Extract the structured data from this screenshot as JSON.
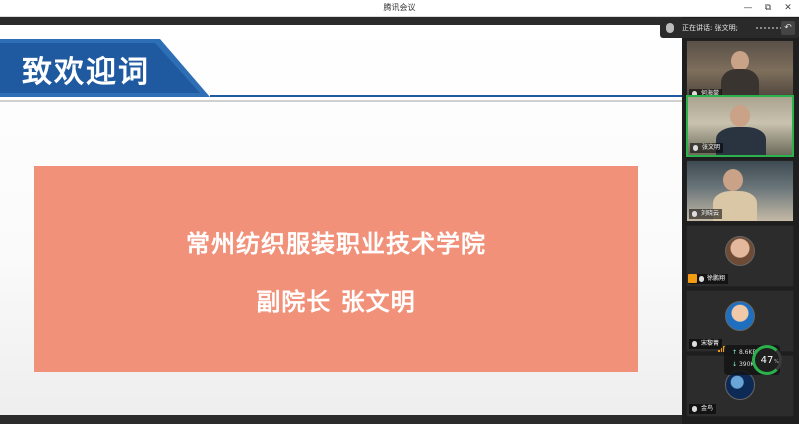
{
  "window": {
    "title": "腾讯会议",
    "controls": {
      "minimize": "—",
      "restore": "⧉",
      "close": "✕"
    }
  },
  "slide": {
    "heading": "致欢迎词",
    "line1": "常州纺织服装职业技术学院",
    "line2": "副院长 张文明",
    "colors": {
      "banner": "#1f5aa0",
      "box": "#f2917a"
    }
  },
  "speaking": {
    "text": "正在讲话: 张文明;"
  },
  "participants": [
    {
      "name": "何海棠",
      "type": "video",
      "active": false
    },
    {
      "name": "张文明",
      "type": "video",
      "active": true
    },
    {
      "name": "刘晓云",
      "type": "video",
      "active": false
    },
    {
      "name": "徐鹏翔",
      "type": "avatar",
      "active": false
    },
    {
      "name": "宋黎菁",
      "type": "avatar",
      "active": false
    },
    {
      "name": "金鸟",
      "type": "avatar",
      "active": false
    }
  ],
  "network": {
    "up": "8.6",
    "down": "390",
    "unit": "KB/s",
    "percent": "47",
    "percent_sign": "%"
  }
}
